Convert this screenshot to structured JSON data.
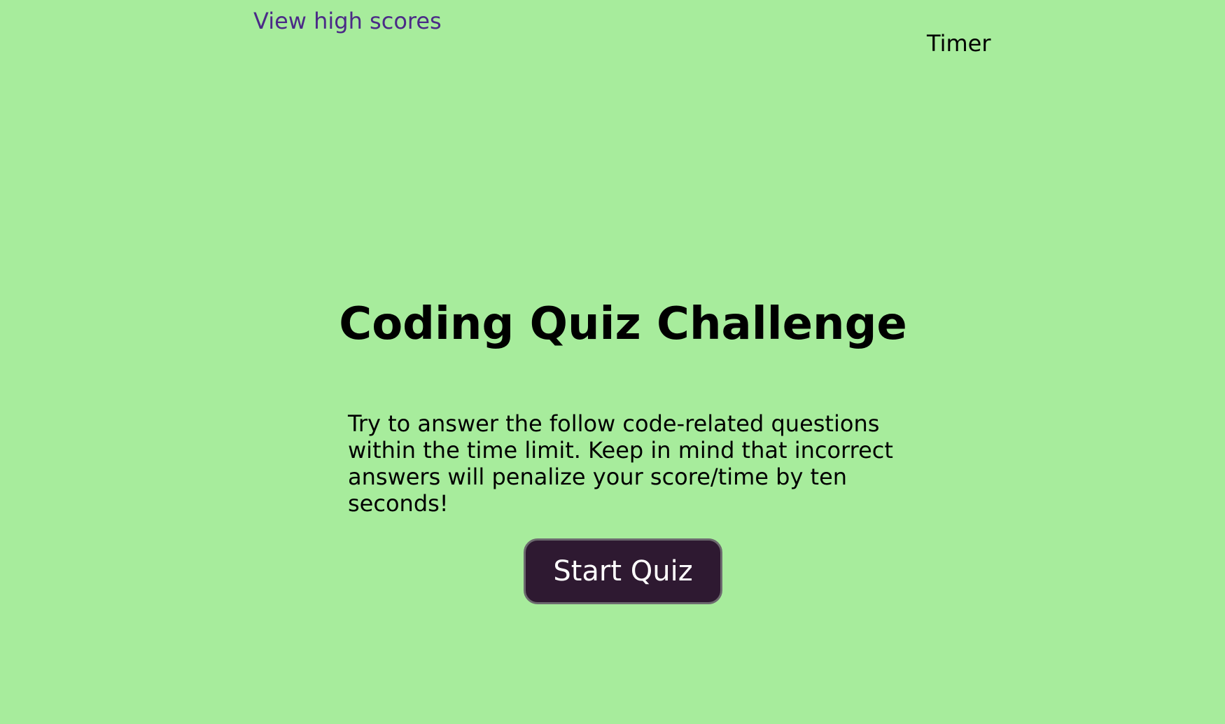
{
  "header": {
    "high_scores_link": "View high scores",
    "timer_label": "Timer"
  },
  "main": {
    "title": "Coding Quiz Challenge",
    "intro": "Try to answer the follow code-related questions within the time limit. Keep in mind that incorrect answers will penalize your score/time by ten seconds!",
    "start_button": "Start Quiz"
  },
  "colors": {
    "background": "#a7ec9c",
    "link": "#4b2a87",
    "button_background": "#2e1931",
    "button_text": "#ffffff"
  }
}
